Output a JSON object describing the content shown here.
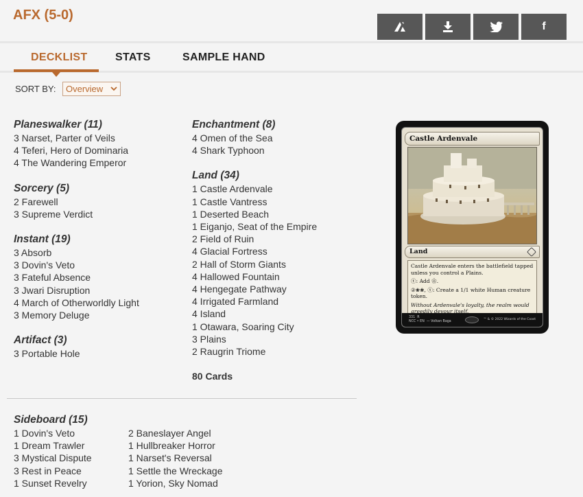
{
  "deck": {
    "title": "AFX (5-0)"
  },
  "share": {
    "buttons": [
      {
        "name": "arena-export",
        "icon": "arena-icon"
      },
      {
        "name": "download",
        "icon": "download-icon"
      },
      {
        "name": "twitter",
        "icon": "twitter-icon"
      },
      {
        "name": "facebook",
        "icon": "facebook-icon",
        "glyph": "f"
      }
    ]
  },
  "tabs": [
    {
      "label": "DECKLIST",
      "active": true
    },
    {
      "label": "STATS",
      "active": false
    },
    {
      "label": "SAMPLE HAND",
      "active": false
    }
  ],
  "sort": {
    "label": "SORT BY:",
    "selected": "Overview"
  },
  "decklist": {
    "column1": [
      {
        "title": "Planeswalker (11)",
        "cards": [
          "3 Narset, Parter of Veils",
          "4 Teferi, Hero of Dominaria",
          "4 The Wandering Emperor"
        ]
      },
      {
        "title": "Sorcery (5)",
        "cards": [
          "2 Farewell",
          "3 Supreme Verdict"
        ]
      },
      {
        "title": "Instant (19)",
        "cards": [
          "3 Absorb",
          "3 Dovin's Veto",
          "3 Fateful Absence",
          "3 Jwari Disruption",
          "4 March of Otherworldly Light",
          "3 Memory Deluge"
        ]
      },
      {
        "title": "Artifact (3)",
        "cards": [
          "3 Portable Hole"
        ]
      }
    ],
    "column2": [
      {
        "title": "Enchantment (8)",
        "cards": [
          "4 Omen of the Sea",
          "4 Shark Typhoon"
        ]
      },
      {
        "title": "Land (34)",
        "cards": [
          "1 Castle Ardenvale",
          "1 Castle Vantress",
          "1 Deserted Beach",
          "1 Eiganjo, Seat of the Empire",
          "2 Field of Ruin",
          "4 Glacial Fortress",
          "2 Hall of Storm Giants",
          "4 Hallowed Fountain",
          "4 Hengegate Pathway",
          "4 Irrigated Farmland",
          "4 Island",
          "1 Otawara, Soaring City",
          "3 Plains",
          "2 Raugrin Triome"
        ]
      }
    ],
    "total": "80 Cards"
  },
  "sideboard": {
    "title": "Sideboard (15)",
    "col1": [
      "1 Dovin's Veto",
      "1 Dream Trawler",
      "3 Mystical Dispute",
      "3 Rest in Peace",
      "1 Sunset Revelry"
    ],
    "col2": [
      "2 Baneslayer Angel",
      "1 Hullbreaker Horror",
      "1 Narset's Reversal",
      "1 Settle the Wreckage",
      "1 Yorion, Sky Nomad"
    ]
  },
  "card_preview": {
    "name": "Castle Ardenvale",
    "type": "Land",
    "rules": [
      "Castle Ardenvale enters the battlefield tapped unless you control a Plains.",
      "ⓣ: Add ❀.",
      "②❀❀, ⓣ: Create a 1/1 white Human creature token."
    ],
    "flavor": "Without Ardenvale's loyalty, the realm would greedily devour itself.",
    "footer_left": "331  R\nNCC • EN  — Volkan Baga",
    "footer_right": "™ & © 2022 Wizards of the Coast"
  },
  "colors": {
    "accent": "#b9692e",
    "share_button": "#575757",
    "background": "#f4f4f4"
  }
}
